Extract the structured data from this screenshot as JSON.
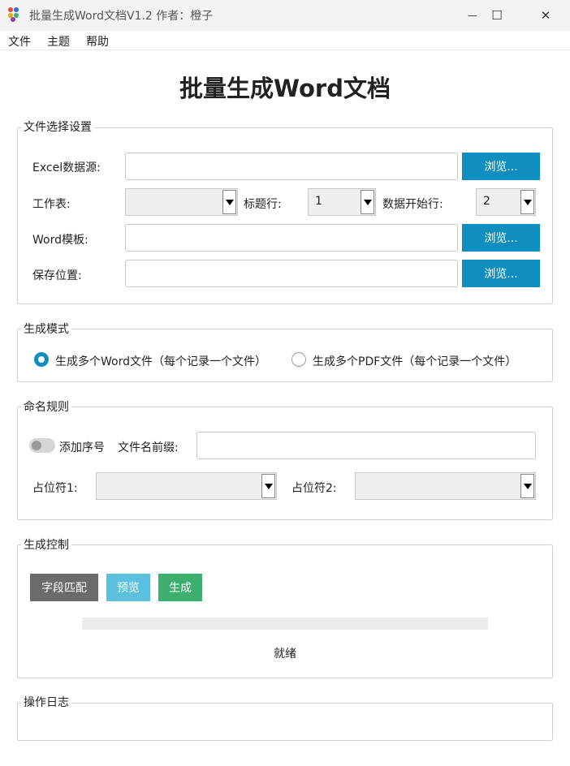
{
  "window": {
    "title": "批量生成Word文档V1.2 作者：橙子",
    "controls": {
      "minimize": "—",
      "maximize": "☐",
      "close": "✕"
    }
  },
  "menu": [
    "文件",
    "主题",
    "帮助"
  ],
  "main_title": "批量生成Word文档",
  "file_settings": {
    "legend": "文件选择设置",
    "excel_label": "Excel数据源:",
    "excel_value": "",
    "sheet_label": "工作表:",
    "sheet_value": "",
    "header_row_label": "标题行:",
    "header_row_value": "1",
    "data_start_label": "数据开始行:",
    "data_start_value": "2",
    "word_label": "Word模板:",
    "word_value": "",
    "save_label": "保存位置:",
    "save_value": "",
    "browse_label": "浏览..."
  },
  "mode": {
    "legend": "生成模式",
    "options": [
      "生成多个Word文件（每个记录一个文件）",
      "生成多个PDF文件（每个记录一个文件）"
    ],
    "selected_index": 0
  },
  "naming": {
    "legend": "命名规则",
    "add_index_label": "添加序号",
    "add_index_on": false,
    "prefix_label": "文件名前缀:",
    "prefix_value": "",
    "placeholder1_label": "占位符1:",
    "placeholder1_value": "",
    "placeholder2_label": "占位符2:",
    "placeholder2_value": ""
  },
  "control": {
    "legend": "生成控制",
    "field_match_label": "字段匹配",
    "preview_label": "预览",
    "generate_label": "生成",
    "progress_fraction": 0,
    "status_text": "就绪"
  },
  "log": {
    "legend": "操作日志"
  },
  "colors": {
    "accent_blue": "#0f8fbf",
    "field_match_bg": "#6b6b6b",
    "preview_bg": "#5bc0de",
    "generate_bg": "#3cae6d",
    "titlebar_bg": "#f3f3f3"
  }
}
